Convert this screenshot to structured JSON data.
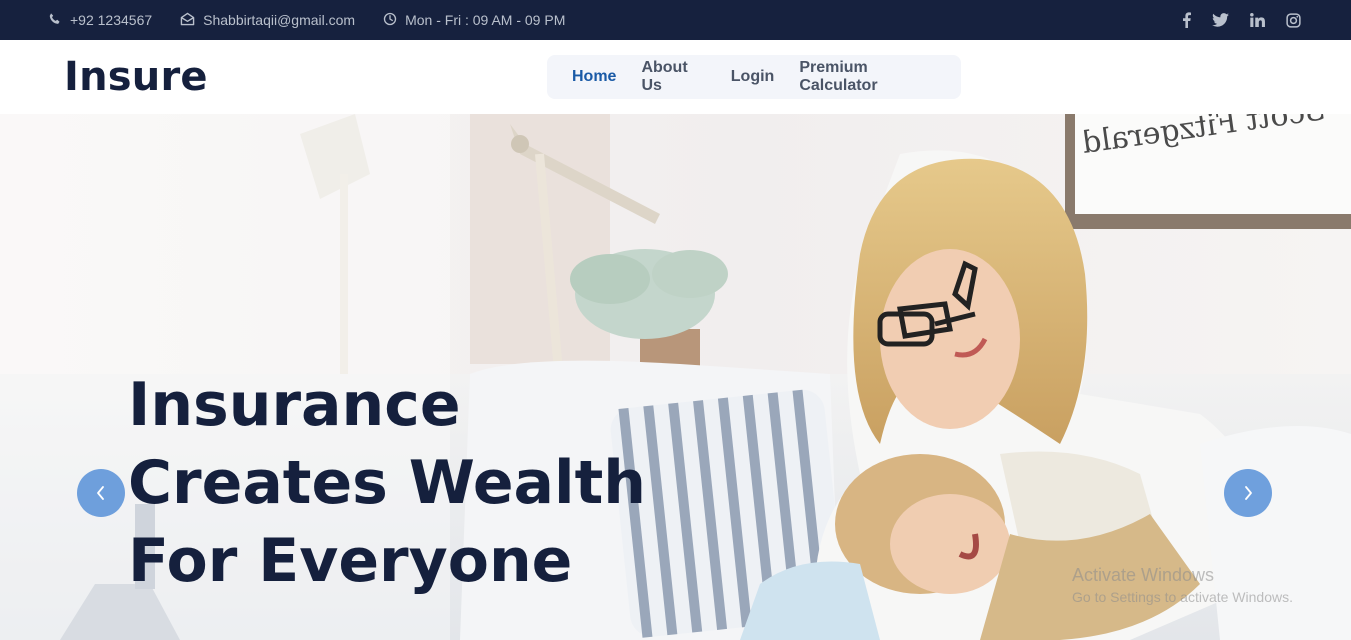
{
  "topbar": {
    "phone": "+92 1234567",
    "email": "Shabbirtaqii@gmail.com",
    "hours": "Mon - Fri : 09 AM - 09 PM",
    "icons": [
      "phone-icon",
      "envelope-icon",
      "clock-icon"
    ],
    "social": [
      "facebook-icon",
      "twitter-icon",
      "linkedin-icon",
      "instagram-icon"
    ]
  },
  "brand": "Insure",
  "nav": {
    "items": [
      "Home",
      "About Us",
      "Login",
      "Premium Calculator"
    ],
    "active": "Home"
  },
  "hero": {
    "title_lines": [
      "Insurance",
      "Creates Wealth",
      "For Everyone"
    ],
    "signature_text": "Scott Fitzgerald",
    "prev_icon": "chevron-left-icon",
    "next_icon": "chevron-right-icon"
  },
  "watermark": {
    "line1": "Activate Windows",
    "line2": "Go to Settings to activate Windows."
  },
  "colors": {
    "topbar_bg": "#16213e",
    "brand": "#15203d",
    "nav_active": "#1a5aa6",
    "nav_bg": "#f3f5fa",
    "carousel_button": "#508cd7"
  }
}
